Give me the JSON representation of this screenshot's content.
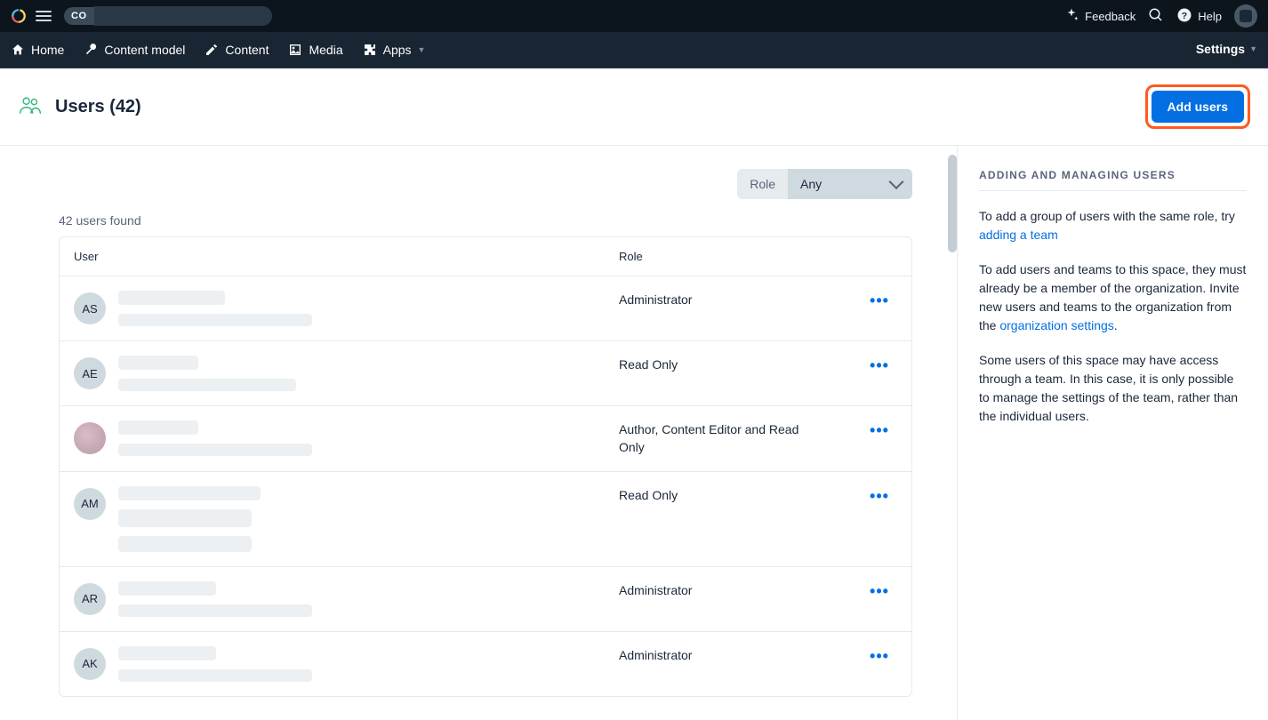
{
  "topbar": {
    "space_badge": "CO",
    "feedback_label": "Feedback",
    "help_label": "Help"
  },
  "nav": {
    "home": "Home",
    "content_model": "Content model",
    "content": "Content",
    "media": "Media",
    "apps": "Apps",
    "settings": "Settings"
  },
  "page": {
    "title": "Users (42)",
    "add_button": "Add users"
  },
  "filter": {
    "label": "Role",
    "value": "Any"
  },
  "found_text": "42 users found",
  "table": {
    "col_user": "User",
    "col_role": "Role",
    "rows": [
      {
        "initials": "AS",
        "role": "Administrator",
        "avatar_type": "initials"
      },
      {
        "initials": "AE",
        "role": "Read Only",
        "avatar_type": "initials"
      },
      {
        "initials": "",
        "role": "Author, Content Editor and Read Only",
        "avatar_type": "image"
      },
      {
        "initials": "AM",
        "role": "Read Only",
        "avatar_type": "initials"
      },
      {
        "initials": "AR",
        "role": "Administrator",
        "avatar_type": "initials"
      },
      {
        "initials": "AK",
        "role": "Administrator",
        "avatar_type": "initials"
      }
    ]
  },
  "sidebar": {
    "heading": "ADDING AND MANAGING USERS",
    "p1_a": "To add a group of users with the same role, try ",
    "p1_link": "adding a team",
    "p2_a": "To add users and teams to this space, they must already be a member of the organization. Invite new users and teams to the organization from the ",
    "p2_link": "organization settings",
    "p2_b": ".",
    "p3": "Some users of this space may have access through a team. In this case, it is only possible to manage the settings of the team, rather than the individual users."
  }
}
